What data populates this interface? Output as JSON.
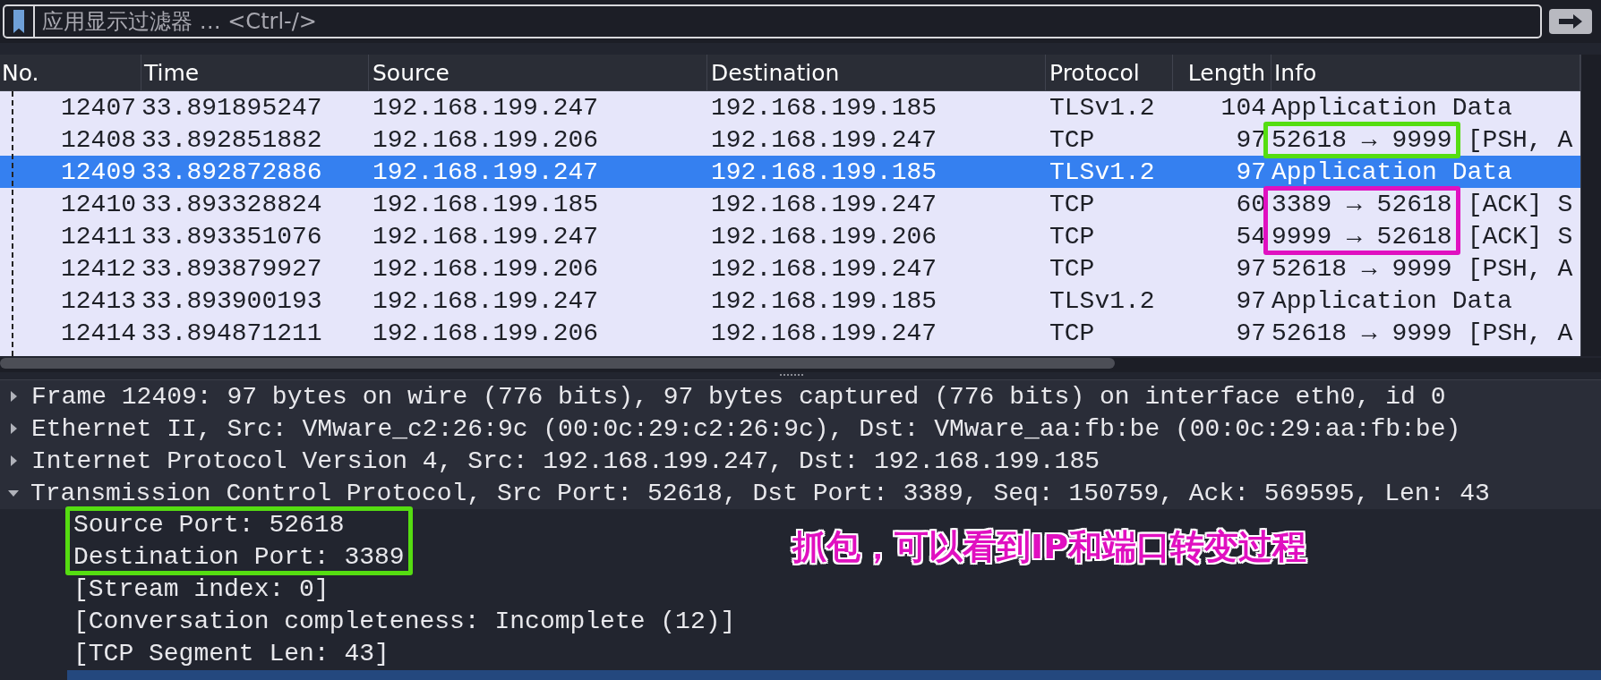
{
  "filter_bar": {
    "placeholder": "应用显示过滤器 … <Ctrl-/>"
  },
  "packet_list": {
    "columns": [
      "No.",
      "Time",
      "Source",
      "Destination",
      "Protocol",
      "Length",
      "Info"
    ],
    "rows": [
      {
        "no": "12407",
        "time": "33.891895247",
        "source": "192.168.199.247",
        "destination": "192.168.199.185",
        "protocol": "TLSv1.2",
        "length": "104",
        "info": [
          "Application Data"
        ],
        "selected": false
      },
      {
        "no": "12408",
        "time": "33.892851882",
        "source": "192.168.199.206",
        "destination": "192.168.199.247",
        "protocol": "TCP",
        "length": "97",
        "info": [
          "52618 → 9999",
          "[PSH, A"
        ],
        "selected": false,
        "color": "#55dd11"
      },
      {
        "no": "12409",
        "time": "33.892872886",
        "source": "192.168.199.247",
        "destination": "192.168.199.185",
        "protocol": "TLSv1.2",
        "length": "97",
        "info": [
          "Application Data"
        ],
        "selected": true
      },
      {
        "no": "12410",
        "time": "33.893328824",
        "source": "192.168.199.185",
        "destination": "192.168.199.247",
        "protocol": "TCP",
        "length": "60",
        "info": [
          "3389 → 52618",
          "[ACK] S"
        ],
        "selected": false,
        "color": "#e010c0"
      },
      {
        "no": "12411",
        "time": "33.893351076",
        "source": "192.168.199.247",
        "destination": "192.168.199.206",
        "protocol": "TCP",
        "length": "54",
        "info": [
          "9999 → 52618",
          "[ACK] S"
        ],
        "selected": false,
        "color": "#e010c0"
      },
      {
        "no": "12412",
        "time": "33.893879927",
        "source": "192.168.199.206",
        "destination": "192.168.199.247",
        "protocol": "TCP",
        "length": "97",
        "info": [
          "52618 → 9999",
          "[PSH, A"
        ],
        "selected": false
      },
      {
        "no": "12413",
        "time": "33.893900193",
        "source": "192.168.199.247",
        "destination": "192.168.199.185",
        "protocol": "TLSv1.2",
        "length": "97",
        "info": [
          "Application Data"
        ],
        "selected": false
      },
      {
        "no": "12414",
        "time": "33.894871211",
        "source": "192.168.199.206",
        "destination": "192.168.199.247",
        "protocol": "TCP",
        "length": "97",
        "info": [
          "52618 → 9999",
          "[PSH, A"
        ],
        "selected": false
      }
    ]
  },
  "packet_details": [
    {
      "label": "Frame 12409: 97 bytes on wire (776 bits), 97 bytes captured (776 bits) on interface eth0, id 0",
      "expanded": false
    },
    {
      "label": "Ethernet II, Src: VMware_c2:26:9c (00:0c:29:c2:26:9c), Dst: VMware_aa:fb:be (00:0c:29:aa:fb:be)",
      "expanded": false
    },
    {
      "label": "Internet Protocol Version 4, Src: 192.168.199.247, Dst: 192.168.199.185",
      "expanded": false
    },
    {
      "label": "Transmission Control Protocol, Src Port: 52618, Dst Port: 3389, Seq: 150759, Ack: 569595, Len: 43",
      "expanded": true,
      "children": [
        {
          "label": "Source Port: 52618",
          "selected": false,
          "color": "#55dd11"
        },
        {
          "label": "Destination Port: 3389",
          "selected": false,
          "color": "#55dd11"
        },
        {
          "label": "[Stream index: 0]",
          "selected": false
        },
        {
          "label": "[Conversation completeness: Incomplete (12)]",
          "selected": false
        },
        {
          "label": "[TCP Segment Len: 43]",
          "selected": false
        },
        {
          "selected": true
        }
      ]
    }
  ],
  "annotation": {
    "text": "抓包，可以看到IP和端口转变过程"
  }
}
